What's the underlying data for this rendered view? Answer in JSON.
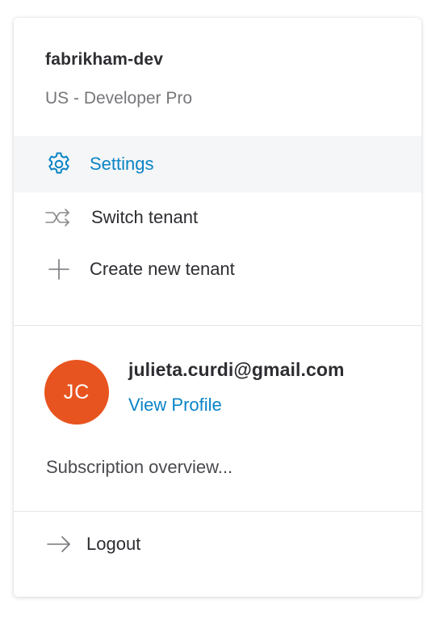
{
  "tenant": {
    "name": "fabrikham-dev",
    "plan": "US - Developer Pro"
  },
  "menu": {
    "items": [
      {
        "label": "Settings",
        "icon": "gear-icon",
        "active": true
      },
      {
        "label": "Switch tenant",
        "icon": "shuffle-icon",
        "active": false
      },
      {
        "label": "Create new tenant",
        "icon": "plus-icon",
        "active": false
      }
    ]
  },
  "user": {
    "initials": "JC",
    "email": "julieta.curdi@gmail.com",
    "view_profile_label": "View Profile",
    "avatar_color": "#e8541f"
  },
  "subscription_label": "Subscription overview...",
  "logout_label": "Logout",
  "colors": {
    "accent": "#0a84c6",
    "text": "#2d2d32",
    "muted": "#77777b",
    "active_bg": "#f5f6f7"
  }
}
